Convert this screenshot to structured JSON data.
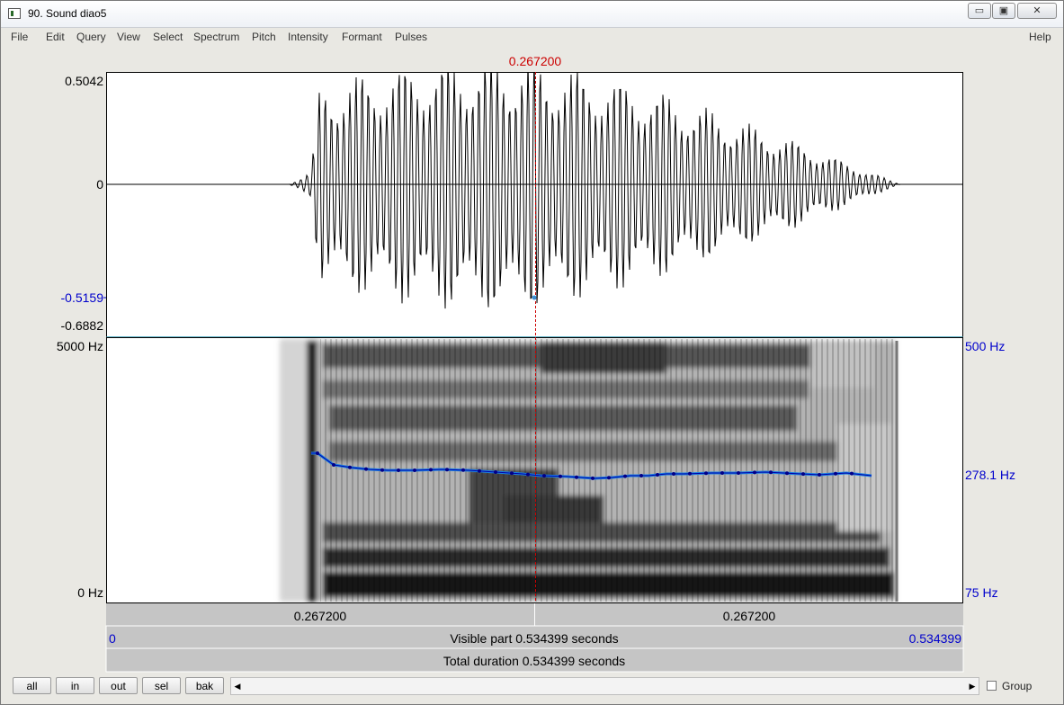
{
  "window": {
    "title": "90. Sound diao5",
    "min": "▭",
    "max": "▣",
    "close": "✕"
  },
  "menu": [
    "File",
    "Edit",
    "Query",
    "View",
    "Select",
    "Spectrum",
    "Pitch",
    "Intensity",
    "Formant",
    "Pulses"
  ],
  "help": "Help",
  "cursor": {
    "time": "0.267200"
  },
  "waveform": {
    "y_max": "0.5042",
    "y_zero": "0",
    "y_cursor": "-0.5159",
    "y_min": "-0.6882"
  },
  "spectrogram": {
    "f_max": "5000 Hz",
    "f_min": "0 Hz"
  },
  "pitch": {
    "p_max": "500 Hz",
    "p_cursor": "278.1 Hz",
    "p_min": "75 Hz"
  },
  "time_bar": {
    "left_label": "0.267200",
    "right_label": "0.267200"
  },
  "visible": {
    "start": "0",
    "label": "Visible part 0.534399 seconds",
    "end": "0.534399"
  },
  "total": {
    "label": "Total duration 0.534399 seconds"
  },
  "buttons": {
    "all": "all",
    "in": "in",
    "out": "out",
    "sel": "sel",
    "bak": "bak"
  },
  "group": "Group",
  "colors": {
    "cursor": "#cc0000",
    "pitch": "#0000cc",
    "pitch_line": "#1a7fe0"
  }
}
